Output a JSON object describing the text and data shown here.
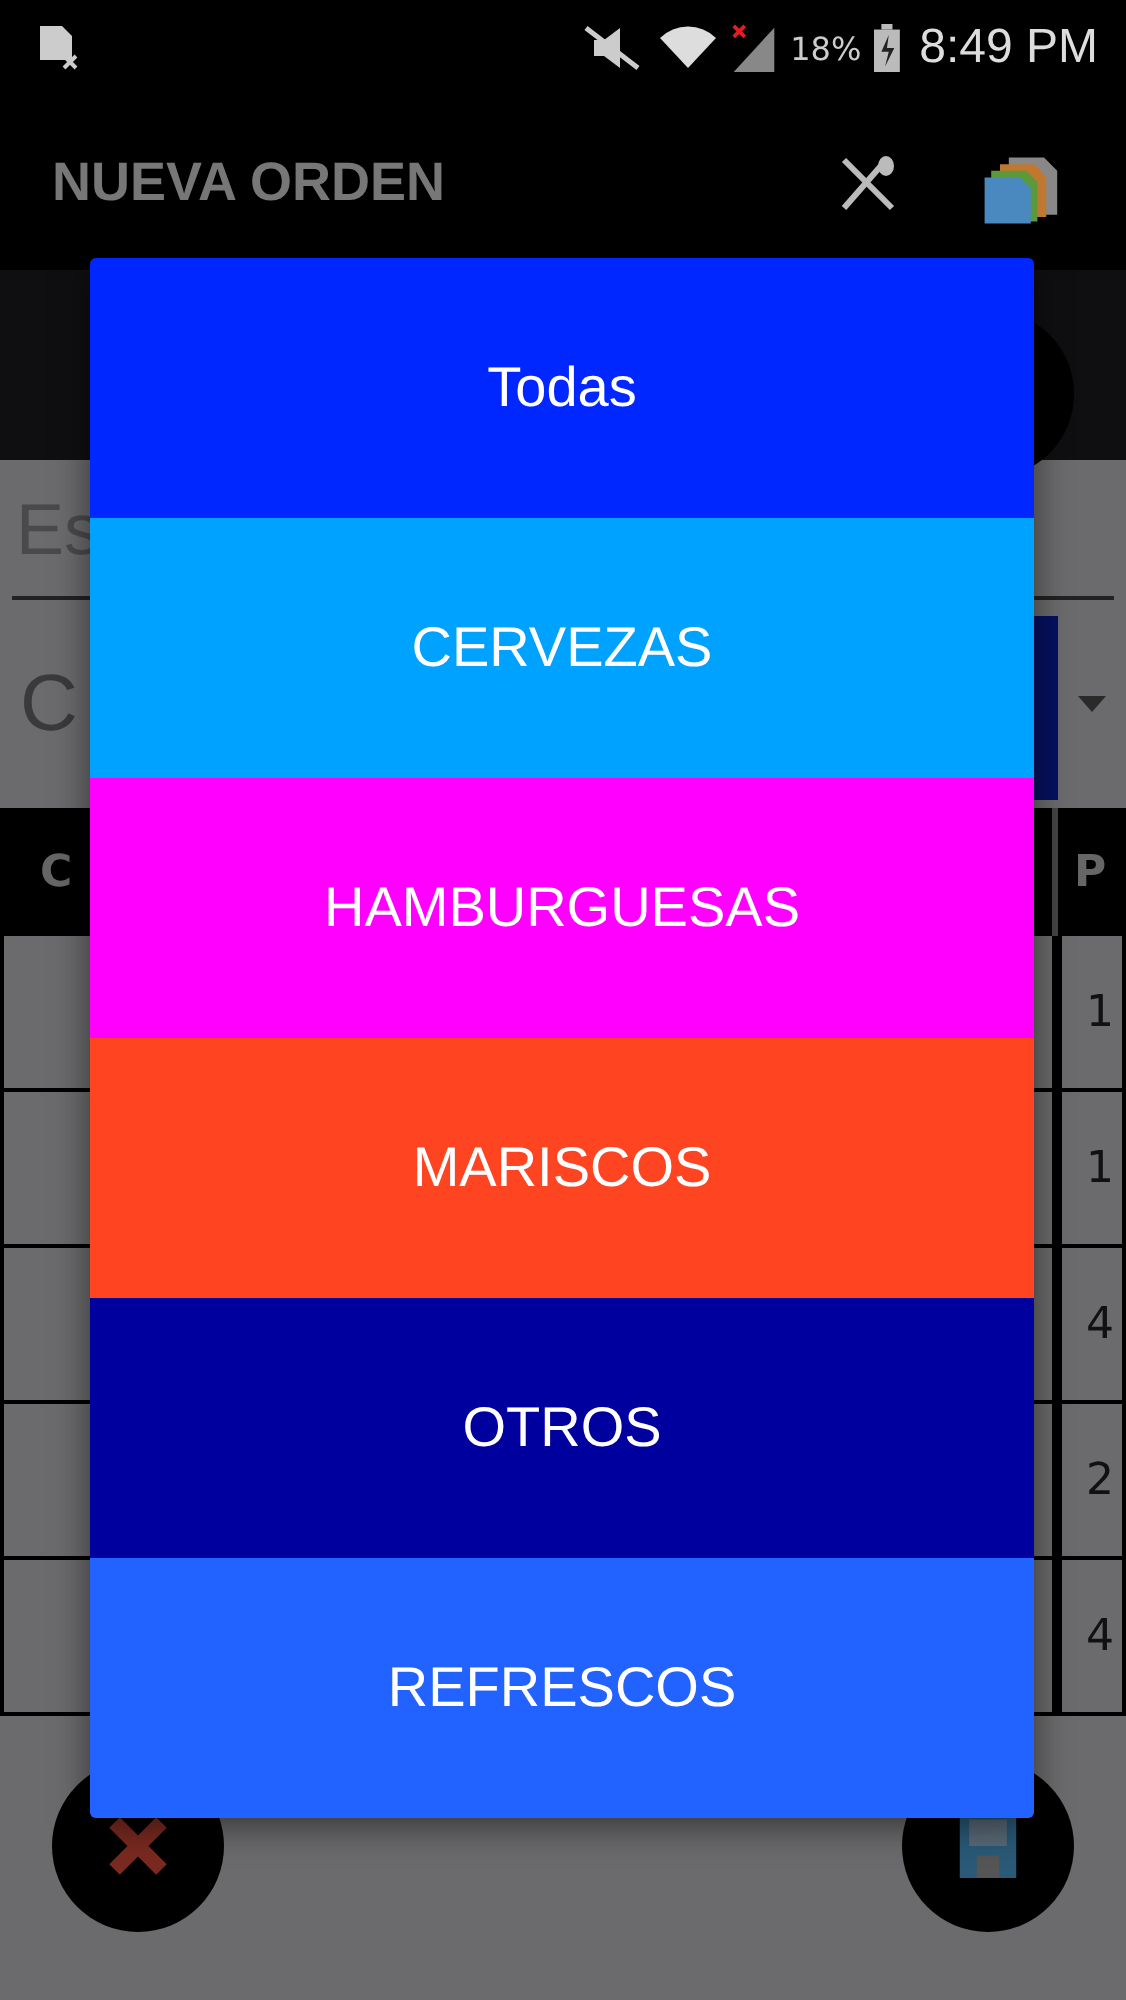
{
  "status_bar": {
    "battery": "18%",
    "time": "8:49 PM"
  },
  "app_bar": {
    "title": "NUEVA ORDEN"
  },
  "background": {
    "search_placeholder": "Es",
    "field_value": "C",
    "table": {
      "header_1": "C",
      "header_2": "P",
      "column_2_values": [
        "1",
        "1",
        "4",
        "2",
        "4"
      ]
    }
  },
  "dialog": {
    "categories": [
      {
        "label": "Todas",
        "color": "#0027ff"
      },
      {
        "label": "CERVEZAS",
        "color": "#00a2ff"
      },
      {
        "label": "HAMBURGUESAS",
        "color": "#ff00ff"
      },
      {
        "label": "MARISCOS",
        "color": "#ff4422"
      },
      {
        "label": "OTROS",
        "color": "#00009e"
      },
      {
        "label": "REFRESCOS",
        "color": "#2262ff"
      }
    ]
  }
}
